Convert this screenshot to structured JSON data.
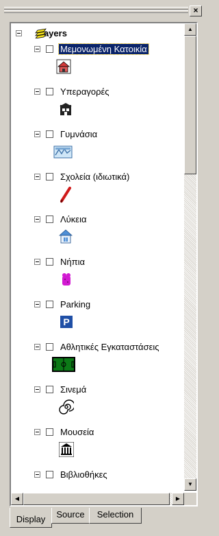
{
  "window": {
    "close_label": "×"
  },
  "toc": {
    "root_label": "Layers",
    "layers": [
      {
        "label": "Μεμονωμένη Κατοικία",
        "icon": "house-icon",
        "selected": true
      },
      {
        "label": "Υπεραγορές",
        "icon": "supermarket-icon"
      },
      {
        "label": "Γυμνάσια",
        "icon": "school-building-icon"
      },
      {
        "label": "Σχολεία (ιδιωτικά)",
        "icon": "pencil-icon"
      },
      {
        "label": "Λύκεια",
        "icon": "school-house-icon"
      },
      {
        "label": "Νήπια",
        "icon": "kindergarten-icon"
      },
      {
        "label": "Parking",
        "icon": "parking-icon"
      },
      {
        "label": "Αθλητικές Εγκαταστάσεις",
        "icon": "sports-field-icon"
      },
      {
        "label": "Σινεμά",
        "icon": "cinema-spiral-icon"
      },
      {
        "label": "Μουσεία",
        "icon": "museum-icon"
      },
      {
        "label": "Βιβλιοθήκες",
        "icon": "library-icon"
      }
    ]
  },
  "tabs": [
    {
      "label": "Display",
      "active": true
    },
    {
      "label": "Source"
    },
    {
      "label": "Selection"
    }
  ],
  "colors": {
    "selection": "#0a246a",
    "parking": "#1f4fa6",
    "field": "#0c7a17",
    "kindergarten": "#d21ad2",
    "pencil": "#d01a1a"
  }
}
